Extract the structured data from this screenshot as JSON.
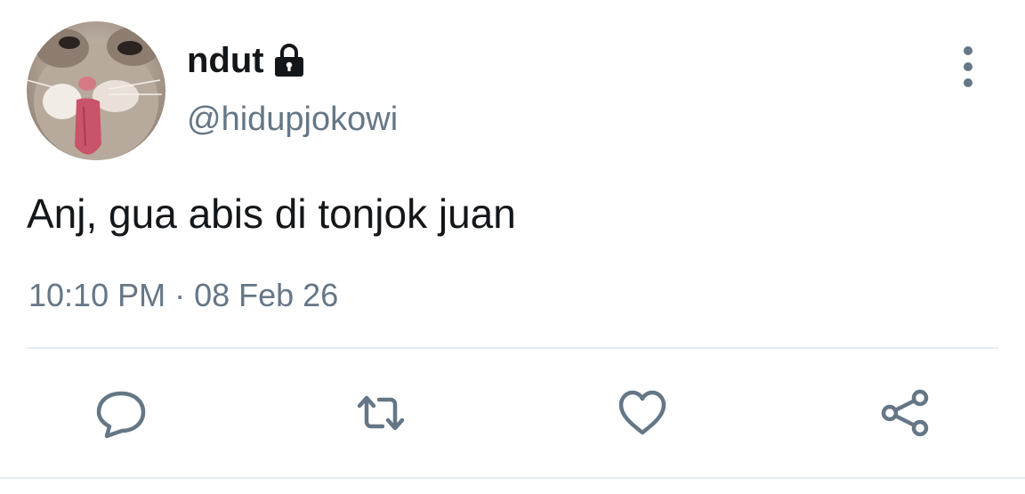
{
  "author": {
    "display_name": "ndut",
    "handle": "@hidupjokowi",
    "protected_icon": "lock-icon",
    "avatar_icon": "cat-avatar"
  },
  "tweet": {
    "text": "Anj, gua abis di tonjok juan",
    "time": "10:10 PM",
    "separator": " · ",
    "date": "08 Feb 26"
  },
  "actions": {
    "reply_icon": "reply-icon",
    "retweet_icon": "retweet-icon",
    "like_icon": "heart-icon",
    "share_icon": "share-icon",
    "more_icon": "more-vertical-icon"
  },
  "colors": {
    "text_primary": "#14171a",
    "text_secondary": "#657786",
    "divider": "#e6ecf0",
    "icon": "#657786"
  }
}
